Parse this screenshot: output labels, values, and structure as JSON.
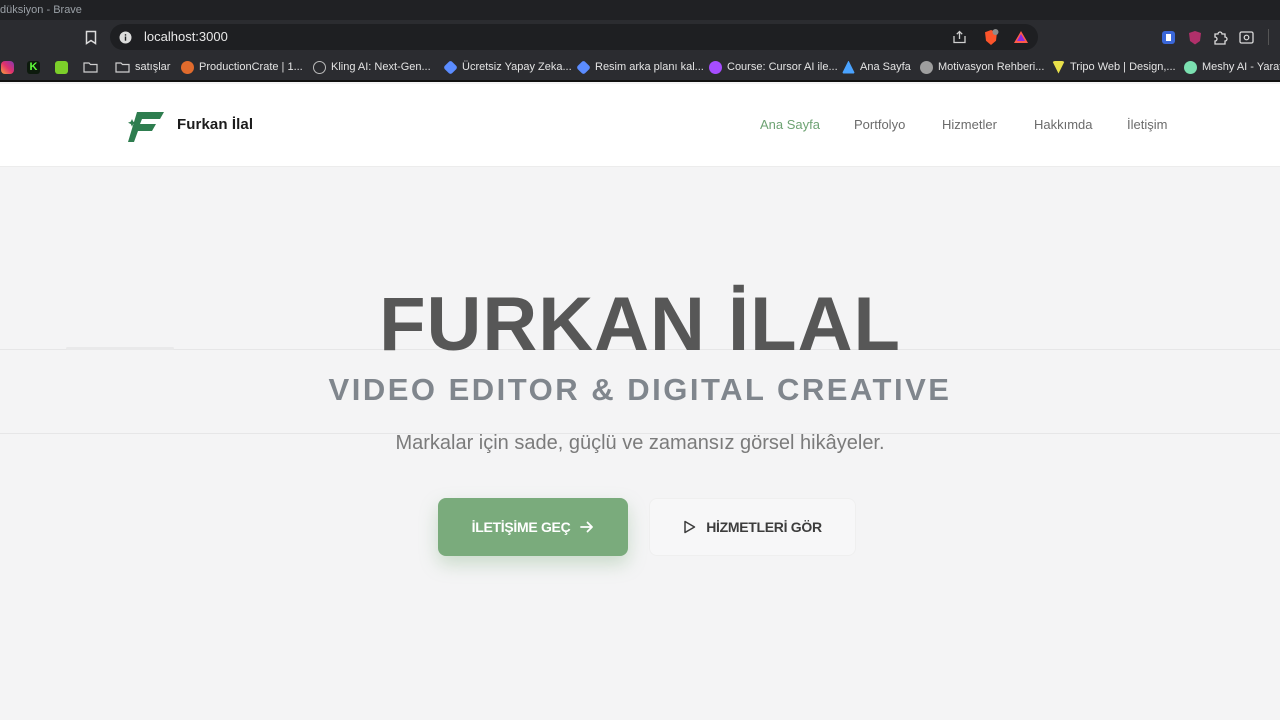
{
  "window": {
    "title": "düksiyon - Brave"
  },
  "address_bar": {
    "url": "localhost:3000"
  },
  "bookmarks": [
    {
      "label": "",
      "icon": "instagram-icon",
      "color": "#e1306c"
    },
    {
      "label": "",
      "icon": "k-icon",
      "color": "#1e2a1a"
    },
    {
      "label": "",
      "icon": "green-app-icon",
      "color": "#7ccf2a"
    },
    {
      "label": "",
      "icon": "folder-icon",
      "color": "#cfcfcf"
    },
    {
      "label": "satışlar",
      "icon": "folder-icon",
      "color": "#cfcfcf"
    },
    {
      "label": "ProductionCrate | 1...",
      "icon": "productioncrate-icon",
      "color": "#e06b2d"
    },
    {
      "label": "Kling AI: Next-Gen...",
      "icon": "kling-icon",
      "color": "#bbbbbb"
    },
    {
      "label": "Ücretsiz Yapay Zeka...",
      "icon": "gem-icon",
      "color": "#5b8cff"
    },
    {
      "label": "Resim arka planı kal...",
      "icon": "gem-icon",
      "color": "#5b8cff"
    },
    {
      "label": "Course: Cursor AI ile...",
      "icon": "course-icon",
      "color": "#a64dff"
    },
    {
      "label": "Ana Sayfa",
      "icon": "ana-sayfa-icon",
      "color": "#4aa3ff"
    },
    {
      "label": "Motivasyon Rehberi...",
      "icon": "globe-icon",
      "color": "#9e9e9e"
    },
    {
      "label": "Tripo Web | Design,...",
      "icon": "tripo-icon",
      "color": "#e8e04a"
    },
    {
      "label": "Meshy AI - Yaratıcı",
      "icon": "meshy-icon",
      "color": "#7be0b0"
    }
  ],
  "site": {
    "brand": "Furkan İlal",
    "nav": [
      {
        "label": "Ana Sayfa",
        "active": true
      },
      {
        "label": "Portfolyo",
        "active": false
      },
      {
        "label": "Hizmetler",
        "active": false
      },
      {
        "label": "Hakkımda",
        "active": false
      },
      {
        "label": "İletişim",
        "active": false
      }
    ],
    "accent_color": "#7aab7c",
    "logo_color": "#2e7d4f"
  },
  "hero": {
    "title": "FURKAN İLAL",
    "subtitle": "VIDEO EDITOR & DIGITAL CREATIVE",
    "tagline": "Markalar için sade, güçlü ve zamansız görsel hikâyeler.",
    "primary_button": "İLETİŞİME GEÇ",
    "secondary_button": "HİZMETLERİ GÖR"
  }
}
